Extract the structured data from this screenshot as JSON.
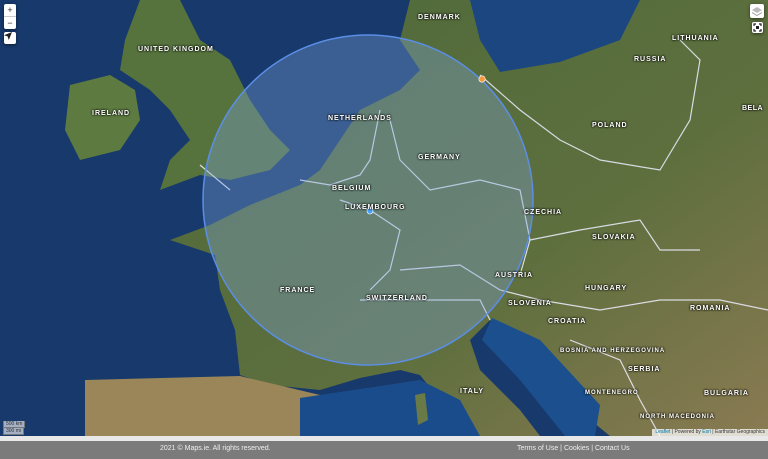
{
  "map": {
    "labels": [
      {
        "text": "UNITED KINGDOM",
        "name": "united-kingdom"
      },
      {
        "text": "IRELAND",
        "name": "ireland"
      },
      {
        "text": "DENMARK",
        "name": "denmark"
      },
      {
        "text": "LITHUANIA",
        "name": "lithuania"
      },
      {
        "text": "RUSSIA",
        "name": "russia"
      },
      {
        "text": "BELA",
        "name": "belarus"
      },
      {
        "text": "NETHERLANDS",
        "name": "netherlands"
      },
      {
        "text": "POLAND",
        "name": "poland"
      },
      {
        "text": "GERMANY",
        "name": "germany"
      },
      {
        "text": "BELGIUM",
        "name": "belgium"
      },
      {
        "text": "LUXEMBOURG",
        "name": "luxembourg"
      },
      {
        "text": "CZECHIA",
        "name": "czechia"
      },
      {
        "text": "SLOVAKIA",
        "name": "slovakia"
      },
      {
        "text": "FRANCE",
        "name": "france"
      },
      {
        "text": "AUSTRIA",
        "name": "austria"
      },
      {
        "text": "HUNGARY",
        "name": "hungary"
      },
      {
        "text": "SWITZERLAND",
        "name": "switzerland"
      },
      {
        "text": "ROMANIA",
        "name": "romania"
      },
      {
        "text": "SLOVENIA",
        "name": "slovenia"
      },
      {
        "text": "CROATIA",
        "name": "croatia"
      },
      {
        "text": "BOSNIA AND HERZEGOVINA",
        "name": "bosnia"
      },
      {
        "text": "SERBIA",
        "name": "serbia"
      },
      {
        "text": "ITALY",
        "name": "italy"
      },
      {
        "text": "MONTENEGRO",
        "name": "montenegro"
      },
      {
        "text": "BULGARIA",
        "name": "bulgaria"
      },
      {
        "text": "NORTH MACEDONIA",
        "name": "north-macedonia"
      }
    ],
    "circle": {
      "stroke": "#5b8ee6",
      "fill": "#7fa6dd"
    },
    "markers": {
      "orange": "#f39a3c",
      "blue": "#4aa3ff"
    }
  },
  "controls": {
    "zoom_in": "+",
    "zoom_out": "−",
    "locate_icon": "navigation-arrow-icon",
    "layers_icon": "layers-icon",
    "fullscreen_icon": "fullscreen-icon"
  },
  "scale": {
    "km": "500 km",
    "mi": "300 mi"
  },
  "attribution": {
    "leaflet": "Leaflet",
    "sep1": " | Powered by ",
    "esri": "Esri",
    "sep2": " | Earthstar Geographics"
  },
  "footer": {
    "copyright": "2021 © Maps.ie. All rights reserved.",
    "terms": "Terms of Use",
    "sep": " | ",
    "cookies": "Cookies",
    "contact": "Contact Us"
  }
}
